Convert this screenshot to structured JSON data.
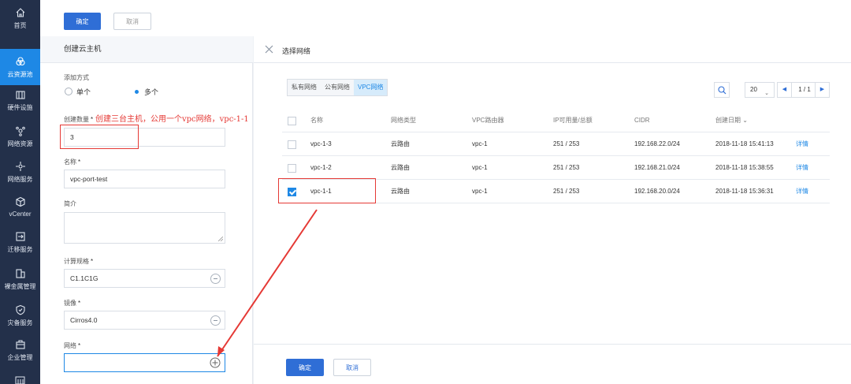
{
  "sidebar": {
    "items": [
      {
        "label": "首页",
        "icon": "home-icon"
      },
      {
        "label": "云资源池",
        "icon": "cloud-pool-icon",
        "active": true
      },
      {
        "label": "硬件设施",
        "icon": "server-rack-icon"
      },
      {
        "label": "网络资源",
        "icon": "network-resource-icon"
      },
      {
        "label": "网络服务",
        "icon": "network-service-icon"
      },
      {
        "label": "vCenter",
        "icon": "vcenter-cube-icon"
      },
      {
        "label": "迁移服务",
        "icon": "migration-icon"
      },
      {
        "label": "裸金属管理",
        "icon": "bare-metal-icon"
      },
      {
        "label": "灾备服务",
        "icon": "disaster-recovery-icon"
      },
      {
        "label": "企业管理",
        "icon": "enterprise-icon"
      }
    ]
  },
  "topbar": {
    "confirm_label": "确定",
    "cancel_label": "取消"
  },
  "form": {
    "title": "创建云主机",
    "add_mode_label": "添加方式",
    "mode_single": "单个",
    "mode_multiple": "多个",
    "selected_mode": "多个",
    "count_label": "创建数量",
    "count_value": "3",
    "name_label": "名称",
    "name_value": "vpc-port-test",
    "desc_label": "简介",
    "desc_value": "",
    "spec_label": "计算规格",
    "spec_value": "C1.1C1G",
    "image_label": "镜像",
    "image_value": "Cirros4.0",
    "network_label": "网络",
    "network_value": "",
    "required_mark": "*"
  },
  "annotation": {
    "text": "创建三台主机，公用一个vpc网络，vpc-1-1",
    "color": "#e53935"
  },
  "dialog": {
    "title": "选择网络",
    "tabs": [
      "私有网络",
      "公有网络",
      "VPC网络"
    ],
    "active_tab": "VPC网络",
    "page_size": "20",
    "page_info": "1 / 1",
    "columns": [
      "名称",
      "网络类型",
      "VPC路由器",
      "IP可用量/总额",
      "CIDR",
      "创建日期"
    ],
    "rows": [
      {
        "name": "vpc-1-3",
        "type": "云路由",
        "router": "vpc-1",
        "ip": "251 / 253",
        "cidr": "192.168.22.0/24",
        "date": "2018-11-18 15:41:13",
        "action": "详情",
        "checked": false
      },
      {
        "name": "vpc-1-2",
        "type": "云路由",
        "router": "vpc-1",
        "ip": "251 / 253",
        "cidr": "192.168.21.0/24",
        "date": "2018-11-18 15:38:55",
        "action": "详情",
        "checked": false
      },
      {
        "name": "vpc-1-1",
        "type": "云路由",
        "router": "vpc-1",
        "ip": "251 / 253",
        "cidr": "192.168.20.0/24",
        "date": "2018-11-18 15:36:31",
        "action": "详情",
        "checked": true
      }
    ],
    "confirm_label": "确定",
    "cancel_label": "取消"
  },
  "colors": {
    "sidebar_bg": "#23304a",
    "accent": "#1e88e5",
    "primary_button": "#2f6ed6",
    "annotation": "#e53935"
  }
}
